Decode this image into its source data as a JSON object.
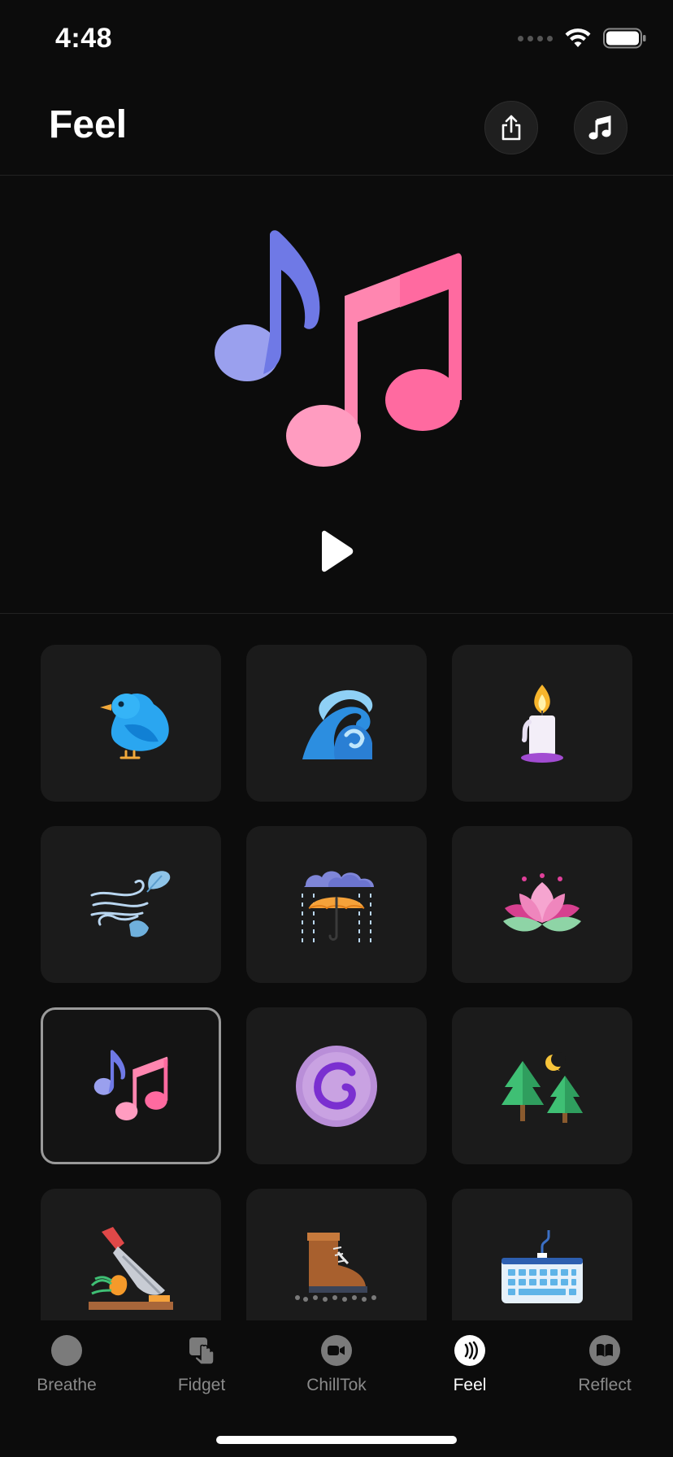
{
  "status_bar": {
    "time": "4:48"
  },
  "header": {
    "title": "Feel",
    "share_icon": "share-icon",
    "music_icon": "music-note-icon"
  },
  "hero": {
    "icon": "music-notes-icon",
    "play_icon": "play-icon"
  },
  "sounds": [
    {
      "icon": "bird-icon",
      "selected": false
    },
    {
      "icon": "wave-icon",
      "selected": false
    },
    {
      "icon": "candle-icon",
      "selected": false
    },
    {
      "icon": "wind-icon",
      "selected": false
    },
    {
      "icon": "rain-umbrella-icon",
      "selected": false
    },
    {
      "icon": "lotus-icon",
      "selected": false
    },
    {
      "icon": "music-notes-icon",
      "selected": true
    },
    {
      "icon": "purple-orb-icon",
      "selected": false
    },
    {
      "icon": "forest-night-icon",
      "selected": false
    },
    {
      "icon": "chopping-knife-icon",
      "selected": false
    },
    {
      "icon": "boot-gravel-icon",
      "selected": false
    },
    {
      "icon": "keyboard-icon",
      "selected": false
    }
  ],
  "tabs": [
    {
      "label": "Breathe",
      "icon": "breathe-icon",
      "active": false
    },
    {
      "label": "Fidget",
      "icon": "fidget-icon",
      "active": false
    },
    {
      "label": "ChillTok",
      "icon": "video-camera-icon",
      "active": false
    },
    {
      "label": "Feel",
      "icon": "haptic-waves-icon",
      "active": true
    },
    {
      "label": "Reflect",
      "icon": "book-icon",
      "active": false
    }
  ]
}
